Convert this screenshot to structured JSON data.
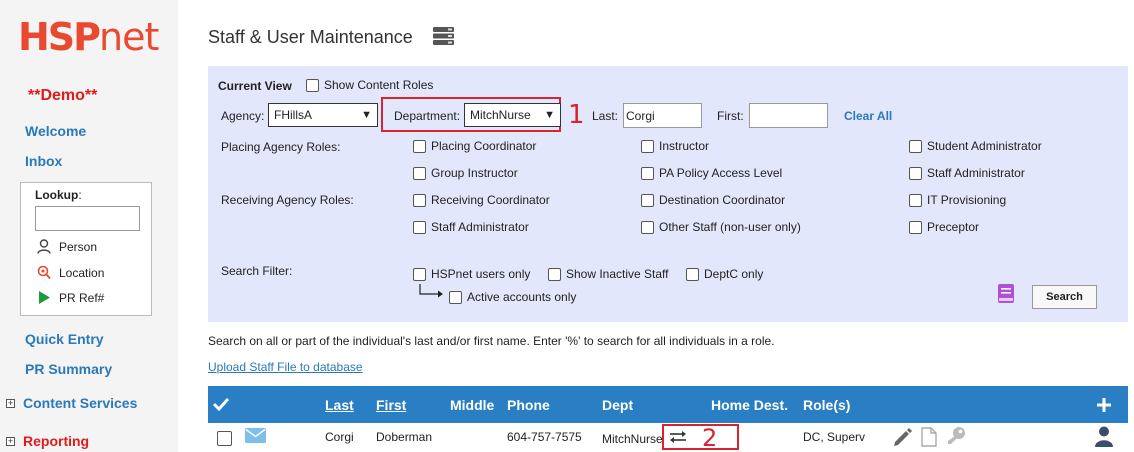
{
  "sidebar": {
    "logo_bold": "HSP",
    "logo_light": "net",
    "demo": "**Demo**",
    "welcome": "Welcome",
    "inbox": "Inbox",
    "lookup": {
      "label": "Lookup",
      "colon": ":",
      "value": "",
      "items": [
        "Person",
        "Location",
        "PR Ref#"
      ]
    },
    "quick_entry": "Quick Entry",
    "pr_summary": "PR Summary",
    "content_services": "Content Services",
    "reporting": "Reporting",
    "expand_symbol": "+"
  },
  "header": {
    "title": "Staff & User Maintenance"
  },
  "filter": {
    "current_view": "Current View",
    "show_content_roles": "Show Content Roles",
    "agency_label": "Agency:",
    "agency_value": "FHillsA",
    "department_label": "Department:",
    "department_value": "MitchNurse",
    "dropdown_arrow": "▼",
    "last_label": "Last:",
    "last_value": "Corgi",
    "first_label": "First:",
    "first_value": "",
    "clear_all": "Clear All",
    "placing_roles_label": "Placing Agency Roles:",
    "receiving_roles_label": "Receiving Agency Roles:",
    "roles_col1": [
      "Placing Coordinator",
      "Group Instructor",
      "Receiving Coordinator",
      "Staff Administrator"
    ],
    "roles_col2": [
      "Instructor",
      "PA Policy Access Level",
      "Destination Coordinator",
      "Other Staff (non-user only)"
    ],
    "roles_col3": [
      "Student Administrator",
      "Staff Administrator",
      "IT Provisioning",
      "Preceptor"
    ],
    "search_filter_label": "Search Filter:",
    "hspnet_users_only": "HSPnet users only",
    "show_inactive_staff": "Show Inactive Staff",
    "deptc_only": "DeptC only",
    "active_accounts_only": "Active accounts only",
    "search_button": "Search"
  },
  "annotations": {
    "marker1": "1",
    "marker2": "2"
  },
  "help_text": "Search on all or part of the individual's last and/or first name. Enter '%' to search for all individuals in a role.",
  "upload_link": "Upload Staff File to database",
  "table": {
    "headers": {
      "last": "Last",
      "first": "First",
      "middle": "Middle",
      "phone": "Phone",
      "dept": "Dept",
      "home_dest": "Home Dest.",
      "roles": "Role(s)"
    },
    "row": {
      "last": "Corgi",
      "first": "Doberman",
      "middle": "",
      "phone": "604-757-7575",
      "dept": "MitchNurse",
      "home_dest": "",
      "roles": "DC, Superv"
    }
  },
  "colors": {
    "brand_red": "#e8492f",
    "link_blue": "#2a79b8",
    "panel_bg": "#e3e7fb",
    "table_header": "#2a7ec3",
    "highlight": "#d9232e"
  }
}
